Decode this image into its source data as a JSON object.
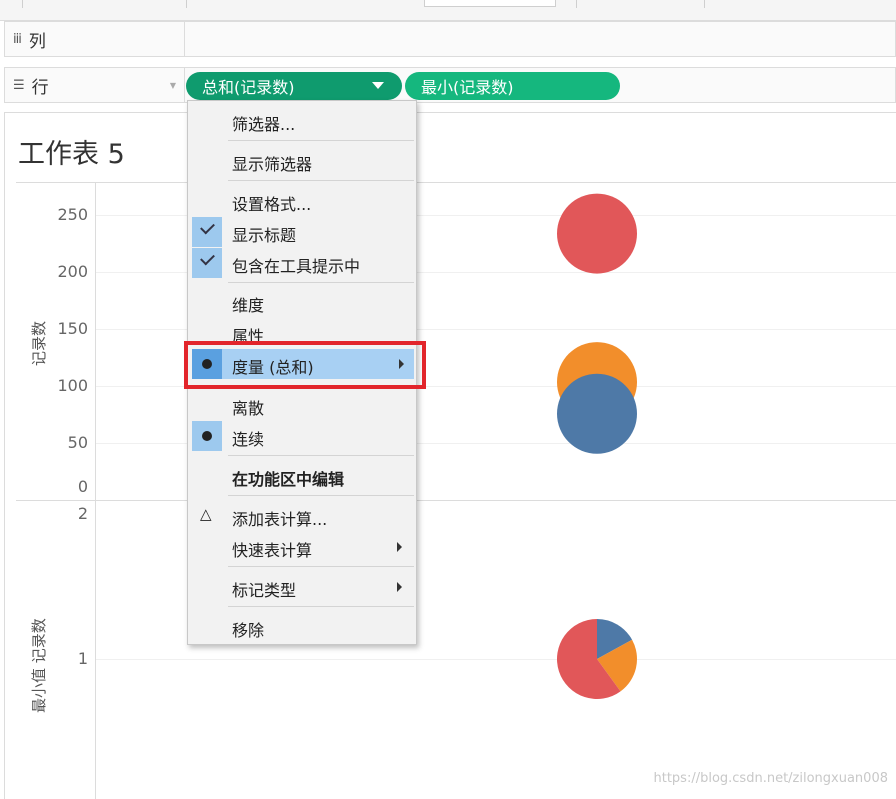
{
  "shelves": {
    "columns": {
      "icon": "iii",
      "label": "列"
    },
    "rows": {
      "icon": "☰",
      "label": "行"
    }
  },
  "pills": [
    {
      "label": "总和(记录数)",
      "color": "#0f9b6e"
    },
    {
      "label": "最小(记录数)",
      "color": "#15b77e"
    }
  ],
  "worksheet": {
    "title": "工作表 5",
    "top_pane": {
      "axis_title": "记录数",
      "ticks": [
        "250",
        "200",
        "150",
        "100",
        "50",
        "0"
      ]
    },
    "bottom_pane": {
      "axis_title": "最小值 记录数",
      "ticks": [
        "2",
        "1"
      ]
    }
  },
  "chart_data": [
    {
      "type": "scatter",
      "ylabel": "记录数",
      "ylim": [
        0,
        270
      ],
      "points": [
        {
          "y": 233,
          "color": "#e15759"
        },
        {
          "y": 97,
          "color": "#f28e2b"
        },
        {
          "y": 68,
          "color": "#4e79a7"
        }
      ]
    },
    {
      "type": "pie",
      "ylabel": "最小值 记录数",
      "ylim": [
        0,
        2
      ],
      "y": 1,
      "slices": [
        {
          "value": 0.17,
          "color": "#4e79a7"
        },
        {
          "value": 0.23,
          "color": "#f28e2b"
        },
        {
          "value": 0.6,
          "color": "#e15759"
        }
      ]
    }
  ],
  "context_menu": {
    "filter": "筛选器...",
    "show_filter": "显示筛选器",
    "format": "设置格式...",
    "show_header": "显示标题",
    "include_tooltip": "包含在工具提示中",
    "dimension": "维度",
    "attribute": "属性",
    "measure": "度量 (总和)",
    "discrete": "离散",
    "continuous": "连续",
    "edit_in_shelf": "在功能区中编辑",
    "add_table_calc": "添加表计算...",
    "quick_table_calc": "快速表计算",
    "mark_type": "标记类型",
    "remove": "移除"
  },
  "watermark": "https://blog.csdn.net/zilongxuan008"
}
